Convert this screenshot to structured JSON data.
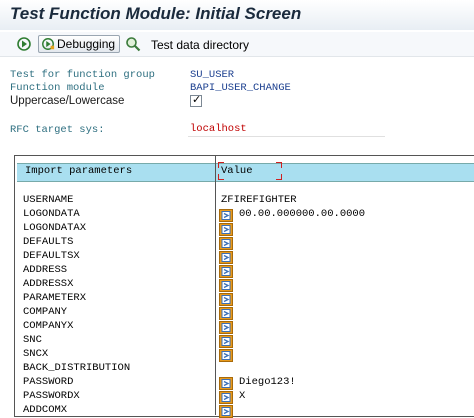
{
  "window": {
    "title": "Test Function Module: Initial Screen"
  },
  "toolbar": {
    "debugging_label": "Debugging",
    "test_data_label": "Test data directory"
  },
  "form": {
    "group_label": "Test for function group",
    "group_value": "SU_USER",
    "module_label": "Function module",
    "module_value": "BAPI_USER_CHANGE",
    "case_label": "Uppercase/Lowercase",
    "case_checked": true,
    "rfc_label": "RFC target sys:",
    "rfc_value": "localhost"
  },
  "table": {
    "col_param": "Import parameters",
    "col_value": "Value",
    "rows": [
      {
        "param": "USERNAME",
        "value": "ZFIREFIGHTER",
        "icon": false
      },
      {
        "param": "LOGONDATA",
        "value": "00.00.000000.00.0000",
        "icon": true
      },
      {
        "param": "LOGONDATAX",
        "value": "",
        "icon": true
      },
      {
        "param": "DEFAULTS",
        "value": "",
        "icon": true
      },
      {
        "param": "DEFAULTSX",
        "value": "",
        "icon": true
      },
      {
        "param": "ADDRESS",
        "value": "",
        "icon": true
      },
      {
        "param": "ADDRESSX",
        "value": "",
        "icon": true
      },
      {
        "param": "PARAMETERX",
        "value": "",
        "icon": true
      },
      {
        "param": "COMPANY",
        "value": "",
        "icon": true
      },
      {
        "param": "COMPANYX",
        "value": "",
        "icon": true
      },
      {
        "param": "SNC",
        "value": "",
        "icon": true
      },
      {
        "param": "SNCX",
        "value": "",
        "icon": true
      },
      {
        "param": "BACK_DISTRIBUTION",
        "value": "",
        "icon": false
      },
      {
        "param": "PASSWORD",
        "value": "Diego123!",
        "icon": true
      },
      {
        "param": "PASSWORDX",
        "value": "X",
        "icon": true
      },
      {
        "param": "ADDCOMX",
        "value": "",
        "icon": true
      }
    ]
  },
  "icons": {
    "execute": "execute-icon",
    "debug": "debug-icon",
    "test_data": "test-data-icon",
    "structure": "structure-editor-icon"
  },
  "colors": {
    "header_bg": "#a9dff0",
    "label": "#2e6f80",
    "value": "#1b3f8f",
    "rfc": "#c00000",
    "struct_icon": "#e89a1c"
  }
}
